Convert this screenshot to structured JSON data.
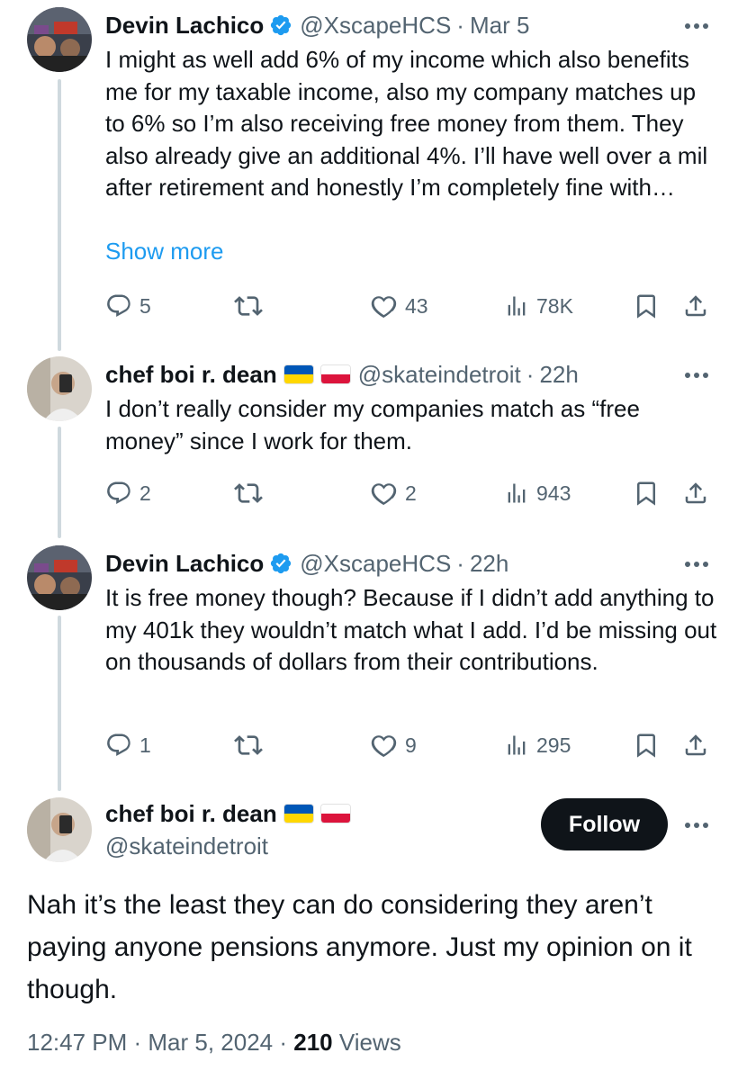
{
  "tweets": [
    {
      "name": "Devin Lachico",
      "verified": true,
      "handle": "@XscapeHCS",
      "time": "Mar 5",
      "text": "I might as well add 6% of my income which also benefits me for my taxable income, also my company matches up to 6% so I’m also receiving free money from them. They also already give an additional 4%. I’ll have well over a mil after retirement and honestly I’m completely fine with…",
      "show_more": "Show more",
      "replies": "5",
      "retweets": "",
      "likes": "43",
      "views": "78K"
    },
    {
      "name": "chef boi r. dean",
      "flags": [
        "ukraine-flag",
        "poland-flag"
      ],
      "handle": "@skateindetroit",
      "time": "22h",
      "text": "I don’t really consider my companies match as “free money” since I work for them.",
      "replies": "2",
      "retweets": "",
      "likes": "2",
      "views": "943"
    },
    {
      "name": "Devin Lachico",
      "verified": true,
      "handle": "@XscapeHCS",
      "time": "22h",
      "text": "It is free money though? Because if I didn’t add anything to my 401k they wouldn’t match what I add. I’d be missing out on thousands of dollars from their contributions.",
      "replies": "1",
      "retweets": "",
      "likes": "9",
      "views": "295"
    }
  ],
  "focus": {
    "name": "chef boi r. dean",
    "flags": [
      "ukraine-flag",
      "poland-flag"
    ],
    "handle": "@skateindetroit",
    "follow_label": "Follow",
    "text": "Nah it’s the least they can do considering they aren’t paying anyone pensions anymore. Just my opinion on it though.",
    "timestamp": "12:47 PM · Mar 5, 2024 · ",
    "views_count": "210",
    "views_label": " Views"
  },
  "colors": {
    "text": "#0f1419",
    "secondary": "#536471",
    "link": "#1d9bf0",
    "verified": "#1d9bf0",
    "thread_line": "#cfd9de",
    "follow_bg": "#0f1419"
  },
  "icons": [
    "verified-badge-icon",
    "more-icon",
    "reply-icon",
    "retweet-icon",
    "like-icon",
    "views-icon",
    "bookmark-icon",
    "share-icon"
  ]
}
